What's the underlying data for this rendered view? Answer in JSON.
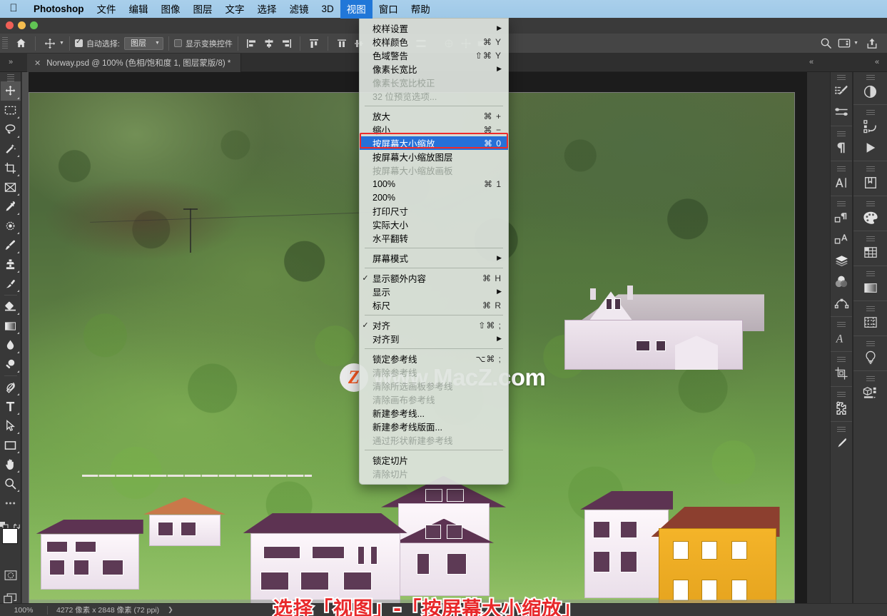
{
  "macbar": {
    "apple_icon": "apple-logo",
    "app_name": "Photoshop",
    "menus": [
      {
        "label": "文件",
        "active": false
      },
      {
        "label": "编辑",
        "active": false
      },
      {
        "label": "图像",
        "active": false
      },
      {
        "label": "图层",
        "active": false
      },
      {
        "label": "文字",
        "active": false
      },
      {
        "label": "选择",
        "active": false
      },
      {
        "label": "滤镜",
        "active": false
      },
      {
        "label": "3D",
        "active": false
      },
      {
        "label": "视图",
        "active": true
      },
      {
        "label": "窗口",
        "active": false
      },
      {
        "label": "帮助",
        "active": false
      }
    ]
  },
  "options_bar": {
    "home_icon": "home-icon",
    "tool_icon": "move-tool-icon",
    "auto_select_checked": true,
    "auto_select_label": "自动选择:",
    "auto_select_value": "图层",
    "show_transform_label": "显示变换控件",
    "show_transform_checked": false,
    "search_icon": "search-icon",
    "workspace_icon": "workspace-icon",
    "share_icon": "share-icon"
  },
  "tab": {
    "close_icon": "close-icon",
    "title": "Norway.psd @ 100% (色相/饱和度 1, 图层蒙版/8) *"
  },
  "toolbar": {
    "tools": [
      {
        "name": "move-tool",
        "selected": true
      },
      {
        "name": "rectangular-marquee-tool",
        "selected": false
      },
      {
        "name": "lasso-tool",
        "selected": false
      },
      {
        "name": "magic-wand-tool",
        "selected": false
      },
      {
        "name": "crop-tool",
        "selected": false
      },
      {
        "name": "frame-tool",
        "selected": false
      },
      {
        "name": "eyedropper-tool",
        "selected": false
      },
      {
        "name": "spot-healing-brush-tool",
        "selected": false
      },
      {
        "name": "brush-tool",
        "selected": false
      },
      {
        "name": "clone-stamp-tool",
        "selected": false
      },
      {
        "name": "history-brush-tool",
        "selected": false
      },
      {
        "name": "eraser-tool",
        "selected": false
      },
      {
        "name": "gradient-tool",
        "selected": false
      },
      {
        "name": "blur-tool",
        "selected": false
      },
      {
        "name": "dodge-tool",
        "selected": false
      },
      {
        "name": "pen-tool",
        "selected": false
      },
      {
        "name": "type-tool",
        "selected": false
      },
      {
        "name": "path-selection-tool",
        "selected": false
      },
      {
        "name": "rectangle-tool",
        "selected": false
      },
      {
        "name": "hand-tool",
        "selected": false
      },
      {
        "name": "zoom-tool",
        "selected": false
      },
      {
        "name": "edit-toolbar-tool",
        "selected": false
      }
    ],
    "foreground_color": "#ffffff",
    "background_color": "#000000"
  },
  "view_menu": {
    "groups": [
      {
        "items": [
          {
            "label": "校样设置",
            "shortcut": "",
            "submenu": true,
            "checked": false,
            "disabled": false,
            "highlighted": false
          },
          {
            "label": "校样颜色",
            "shortcut": "⌘ Y",
            "submenu": false,
            "checked": false,
            "disabled": false,
            "highlighted": false
          },
          {
            "label": "色域警告",
            "shortcut": "⇧⌘ Y",
            "submenu": false,
            "checked": false,
            "disabled": false,
            "highlighted": false
          },
          {
            "label": "像素长宽比",
            "shortcut": "",
            "submenu": true,
            "checked": false,
            "disabled": false,
            "highlighted": false
          },
          {
            "label": "像素长宽比校正",
            "shortcut": "",
            "submenu": false,
            "checked": false,
            "disabled": true,
            "highlighted": false
          },
          {
            "label": "32 位预览选项...",
            "shortcut": "",
            "submenu": false,
            "checked": false,
            "disabled": true,
            "highlighted": false
          }
        ]
      },
      {
        "items": [
          {
            "label": "放大",
            "shortcut": "⌘ +",
            "submenu": false,
            "checked": false,
            "disabled": false,
            "highlighted": false
          },
          {
            "label": "缩小",
            "shortcut": "⌘ −",
            "submenu": false,
            "checked": false,
            "disabled": false,
            "highlighted": false
          },
          {
            "label": "按屏幕大小缩放",
            "shortcut": "⌘ 0",
            "submenu": false,
            "checked": false,
            "disabled": false,
            "highlighted": true
          },
          {
            "label": "按屏幕大小缩放图层",
            "shortcut": "",
            "submenu": false,
            "checked": false,
            "disabled": false,
            "highlighted": false
          },
          {
            "label": "按屏幕大小缩放画板",
            "shortcut": "",
            "submenu": false,
            "checked": false,
            "disabled": true,
            "highlighted": false
          },
          {
            "label": "100%",
            "shortcut": "⌘ 1",
            "submenu": false,
            "checked": false,
            "disabled": false,
            "highlighted": false
          },
          {
            "label": "200%",
            "shortcut": "",
            "submenu": false,
            "checked": false,
            "disabled": false,
            "highlighted": false
          },
          {
            "label": "打印尺寸",
            "shortcut": "",
            "submenu": false,
            "checked": false,
            "disabled": false,
            "highlighted": false
          },
          {
            "label": "实际大小",
            "shortcut": "",
            "submenu": false,
            "checked": false,
            "disabled": false,
            "highlighted": false
          },
          {
            "label": "水平翻转",
            "shortcut": "",
            "submenu": false,
            "checked": false,
            "disabled": false,
            "highlighted": false
          }
        ]
      },
      {
        "items": [
          {
            "label": "屏幕模式",
            "shortcut": "",
            "submenu": true,
            "checked": false,
            "disabled": false,
            "highlighted": false
          }
        ]
      },
      {
        "items": [
          {
            "label": "显示额外内容",
            "shortcut": "⌘ H",
            "submenu": false,
            "checked": true,
            "disabled": false,
            "highlighted": false
          },
          {
            "label": "显示",
            "shortcut": "",
            "submenu": true,
            "checked": false,
            "disabled": false,
            "highlighted": false
          },
          {
            "label": "标尺",
            "shortcut": "⌘ R",
            "submenu": false,
            "checked": false,
            "disabled": false,
            "highlighted": false
          }
        ]
      },
      {
        "items": [
          {
            "label": "对齐",
            "shortcut": "⇧⌘ ;",
            "submenu": false,
            "checked": true,
            "disabled": false,
            "highlighted": false
          },
          {
            "label": "对齐到",
            "shortcut": "",
            "submenu": true,
            "checked": false,
            "disabled": false,
            "highlighted": false
          }
        ]
      },
      {
        "items": [
          {
            "label": "锁定参考线",
            "shortcut": "⌥⌘ ;",
            "submenu": false,
            "checked": false,
            "disabled": false,
            "highlighted": false
          },
          {
            "label": "清除参考线",
            "shortcut": "",
            "submenu": false,
            "checked": false,
            "disabled": true,
            "highlighted": false
          },
          {
            "label": "清除所选画板参考线",
            "shortcut": "",
            "submenu": false,
            "checked": false,
            "disabled": true,
            "highlighted": false
          },
          {
            "label": "清除画布参考线",
            "shortcut": "",
            "submenu": false,
            "checked": false,
            "disabled": true,
            "highlighted": false
          },
          {
            "label": "新建参考线...",
            "shortcut": "",
            "submenu": false,
            "checked": false,
            "disabled": false,
            "highlighted": false
          },
          {
            "label": "新建参考线版面...",
            "shortcut": "",
            "submenu": false,
            "checked": false,
            "disabled": false,
            "highlighted": false
          },
          {
            "label": "通过形状新建参考线",
            "shortcut": "",
            "submenu": false,
            "checked": false,
            "disabled": true,
            "highlighted": false
          }
        ]
      },
      {
        "items": [
          {
            "label": "锁定切片",
            "shortcut": "",
            "submenu": false,
            "checked": false,
            "disabled": false,
            "highlighted": false
          },
          {
            "label": "清除切片",
            "shortcut": "",
            "submenu": false,
            "checked": false,
            "disabled": true,
            "highlighted": false
          }
        ]
      }
    ],
    "highlight_color": "#2670d8",
    "ring_color": "#ee2b2b"
  },
  "canvas": {
    "watermark_badge": "Z",
    "watermark_text": "www.MacZ.com",
    "caption": "选择「视图」-「按屏幕大小缩放」",
    "caption_color": "#e8282a"
  },
  "status_bar": {
    "zoom": "100%",
    "dimensions": "4272 像素 x 2848 像素 (72 ppi)",
    "arrow_icon": "chevron-right-icon"
  },
  "right_dock": {
    "column1": [
      {
        "name": "brush-settings-icon"
      },
      {
        "name": "brush-presets-icon"
      },
      {
        "name": "paragraph-icon"
      },
      {
        "name": "character-icon"
      },
      {
        "name": "paragraph-styles-icon"
      },
      {
        "name": "character-styles-icon"
      },
      {
        "name": "layers-icon"
      },
      {
        "name": "channels-icon"
      },
      {
        "name": "paths-icon"
      },
      {
        "name": "glyphs-icon"
      },
      {
        "name": "crop-properties-icon"
      },
      {
        "name": "puzzle-plugins-icon"
      },
      {
        "name": "tool-preset-icon"
      }
    ],
    "column2": [
      {
        "name": "adjustments-icon"
      },
      {
        "name": "actions-icon"
      },
      {
        "name": "timeline-play-icon"
      },
      {
        "name": "libraries-icon"
      },
      {
        "name": "color-palette-icon"
      },
      {
        "name": "swatches-grid-icon"
      },
      {
        "name": "gradients-icon"
      },
      {
        "name": "patterns-icon"
      },
      {
        "name": "learn-bulb-icon"
      },
      {
        "name": "3d-icon"
      }
    ]
  }
}
